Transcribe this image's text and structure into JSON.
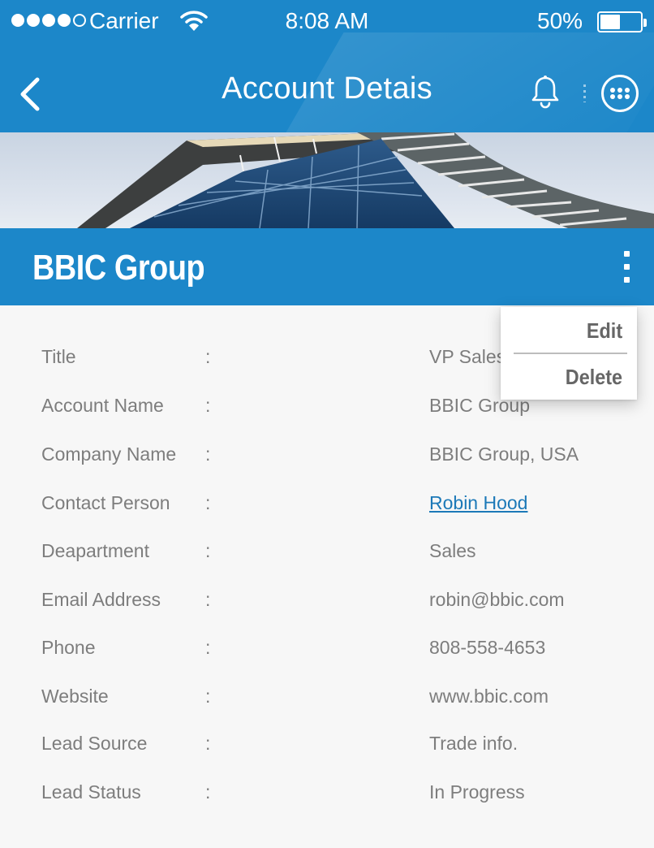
{
  "status_bar": {
    "carrier": "Carrier",
    "time": "8:08 AM",
    "battery": "50%",
    "battery_level": 0.5,
    "signal_bars_filled": 4,
    "signal_bars_total": 5
  },
  "navbar": {
    "title": "Account Detais",
    "icons": {
      "back": "chevron-left-icon",
      "notifications": "bell-icon",
      "more": "more-circle-icon"
    }
  },
  "account": {
    "name": "BBIC Group",
    "menu_icon": "kebab-vertical-icon"
  },
  "popup_menu": {
    "items": [
      {
        "label": "Edit"
      },
      {
        "label": "Delete"
      }
    ]
  },
  "details": {
    "separator": ":",
    "rows": [
      {
        "label": "Title",
        "value": "VP Sales"
      },
      {
        "label": "Account Name",
        "value": "BBIC Group"
      },
      {
        "label": "Company Name",
        "value": "BBIC Group, USA"
      },
      {
        "label": "Contact Person",
        "value": "Robin Hood"
      },
      {
        "label": "Deapartment",
        "value": "Sales"
      },
      {
        "label": "Email Address",
        "value": "robin@bbic.com"
      },
      {
        "label": "Phone",
        "value": "808-558-4653"
      },
      {
        "label": "Website",
        "value": "www.bbic.com"
      },
      {
        "label": "Lead Source",
        "value": "Trade info."
      },
      {
        "label": "Lead Status",
        "value": "In Progress"
      }
    ]
  },
  "colors": {
    "primary": "#1c87c9",
    "link": "#1c79b8",
    "text": "#7d7d7d",
    "background": "#f7f7f7"
  }
}
